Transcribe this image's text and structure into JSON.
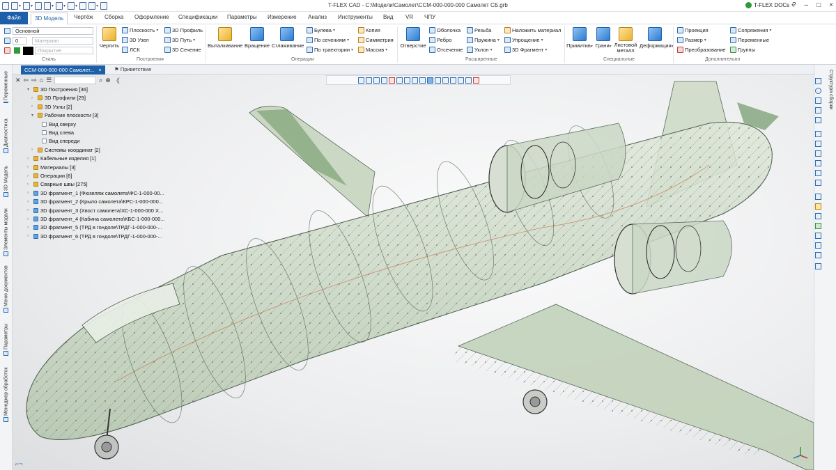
{
  "window": {
    "title": "T-FLEX CAD - C:\\Модели\\Самолет\\CCM-000-000-000 Самолет СБ.grb",
    "docs_label": "T-FLEX DOCs",
    "controls": [
      "?",
      "–",
      "□",
      "×"
    ]
  },
  "menu": {
    "file": "Файл",
    "tabs": [
      "3D Модель",
      "Чертёж",
      "Сборка",
      "Оформление",
      "Спецификации",
      "Параметры",
      "Измерение",
      "Анализ",
      "Инструменты",
      "Вид",
      "VR",
      "ЧПУ"
    ]
  },
  "ribbon": {
    "style": {
      "layer": "Основной",
      "layer_num": "0",
      "material": "Материал",
      "surface": "Покрытие",
      "label": "Стиль"
    },
    "construct": {
      "sketch": "Чертить",
      "plane": "Плоскость",
      "node3d": "3D Узел",
      "lsk": "ЛСК",
      "profile3d": "3D Профиль",
      "path3d": "3D Путь",
      "section3d": "3D Сечение",
      "label": "Построения"
    },
    "operations": {
      "extrude": "Выталкивание",
      "rotate": "Вращение",
      "smooth": "Сглаживание",
      "boolean": "Булева",
      "by_sections": "По сечениям",
      "by_trajectory": "По траектории",
      "copy": "Копия",
      "symmetry": "Симметрия",
      "array": "Массив",
      "label": "Операции"
    },
    "extended": {
      "hole": "Отверстие",
      "shell": "Оболочка",
      "rib": "Ребро",
      "cut": "Отсечение",
      "thread": "Резьба",
      "spring": "Пружина",
      "slope": "Уклон",
      "apply_material": "Наложить материал",
      "simplify": "Упрощение",
      "fragment3d": "3D Фрагмент",
      "label": "Расширенные"
    },
    "special": {
      "primitives": "Примитив",
      "faces": "Грани",
      "sheet_metal": "Листовой металл",
      "deform": "Деформация",
      "label": "Специальные"
    },
    "additional": {
      "projection": "Проекция",
      "dimension": "Размер",
      "transform": "Преобразование",
      "mates": "Сопряжения",
      "variables": "Переменные",
      "groups": "Группы",
      "label": "Дополнительно"
    }
  },
  "left_tabs": [
    "Переменные",
    "Диагностика",
    "3D Модель",
    "Элементы модели",
    "Меню документов",
    "Параметры",
    "Менеджер обработок"
  ],
  "doc_tabs": {
    "active": "CCM-000-000-000 Самолет...",
    "active_close": "×",
    "welcome": "Приветствие"
  },
  "tree": [
    {
      "label": "3D Построения [36]",
      "level": 0,
      "icon": "f",
      "exp": "▾"
    },
    {
      "label": "3D Профили [29]",
      "level": 1,
      "icon": "f",
      "exp": "›"
    },
    {
      "label": "3D Узлы [2]",
      "level": 1,
      "icon": "f",
      "exp": "›"
    },
    {
      "label": "Рабочие плоскости [3]",
      "level": 1,
      "icon": "f",
      "exp": "▾"
    },
    {
      "label": "Вид сверху",
      "level": 2,
      "icon": "p",
      "exp": ""
    },
    {
      "label": "Вид слева",
      "level": 2,
      "icon": "p",
      "exp": ""
    },
    {
      "label": "Вид спереди",
      "level": 2,
      "icon": "p",
      "exp": ""
    },
    {
      "label": "Системы координат [2]",
      "level": 1,
      "icon": "f",
      "exp": "›"
    },
    {
      "label": "Кабельные изделия [1]",
      "level": 0,
      "icon": "f",
      "exp": "›"
    },
    {
      "label": "Материалы [3]",
      "level": 0,
      "icon": "f",
      "exp": "›"
    },
    {
      "label": "Операции [6]",
      "level": 0,
      "icon": "f",
      "exp": "›"
    },
    {
      "label": "Сварные швы [275]",
      "level": 0,
      "icon": "f",
      "exp": "›"
    },
    {
      "label": "3D фрагмент_1 (Фюзеляж самолета\\ФС-1-000-00...",
      "level": 0,
      "icon": "m",
      "exp": "›"
    },
    {
      "label": "3D фрагмент_2 (Крыло самолета\\КРС-1-000-000...",
      "level": 0,
      "icon": "m",
      "exp": "›"
    },
    {
      "label": "3D фрагмент_3 (Хвост самолета\\ХС-1-000-000 Х...",
      "level": 0,
      "icon": "m",
      "exp": "›"
    },
    {
      "label": "3D фрагмент_4 (Кабина самолета\\КБС-1-000-000...",
      "level": 0,
      "icon": "m",
      "exp": "›"
    },
    {
      "label": "3D фрагмент_5 (ТРД в гондоле\\ТРДГ-1-000-000-...",
      "level": 0,
      "icon": "m",
      "exp": "›"
    },
    {
      "label": "3D фрагмент_6 (ТРД в гондоле\\ТРДГ-1-000-000-...",
      "level": 0,
      "icon": "m",
      "exp": "›"
    }
  ],
  "right_tab": "Структура сборки",
  "colors": {
    "accent": "#1d5fa8",
    "model_fill": "#c9d8c4",
    "model_stroke": "#4a5a4c",
    "wing_green": "#6f9a66"
  }
}
